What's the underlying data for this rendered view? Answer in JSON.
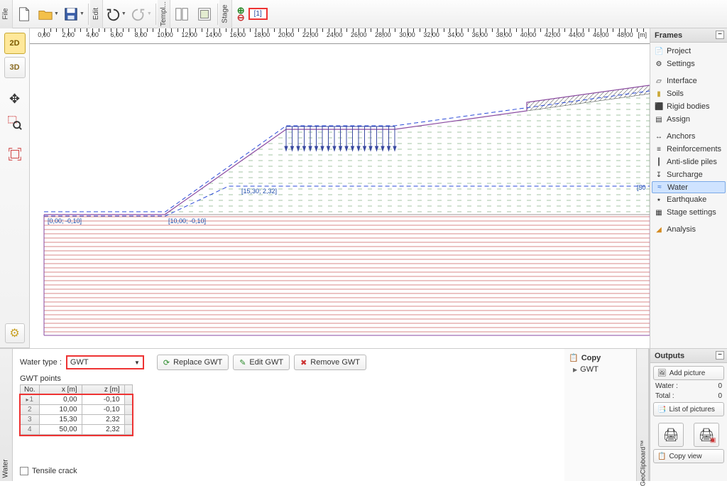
{
  "toolbar": {
    "file_tab": "File",
    "edit_tab": "Edit",
    "templ_tab": "Templ...",
    "stage_tab": "Stage",
    "stage_btn": "[1]"
  },
  "ruler": {
    "labels": [
      "0,00",
      "2,00",
      "4,00",
      "6,00",
      "8,00",
      "10,00",
      "12,00",
      "14,00",
      "16,00",
      "18,00",
      "20,00",
      "22,00",
      "24,00",
      "26,00",
      "28,00",
      "30,00",
      "32,00",
      "34,00",
      "36,00",
      "38,00",
      "40,00",
      "42,00",
      "44,00",
      "46,00",
      "48,00"
    ],
    "unit": "[m]"
  },
  "canvas": {
    "label1": "[0,00; -0,10]",
    "label2": "[10,00; -0,10]",
    "label3": "[15,30; 2,32]",
    "right_y": "[50"
  },
  "frames": {
    "title": "Frames",
    "items": [
      {
        "label": "Project",
        "icon": "📄"
      },
      {
        "label": "Settings",
        "icon": "⚙"
      },
      {
        "label": "Interface",
        "icon": "▱"
      },
      {
        "label": "Soils",
        "icon": "▮"
      },
      {
        "label": "Rigid bodies",
        "icon": "⬛"
      },
      {
        "label": "Assign",
        "icon": "▤"
      },
      {
        "label": "Anchors",
        "icon": "↔"
      },
      {
        "label": "Reinforcements",
        "icon": "≡"
      },
      {
        "label": "Anti-slide piles",
        "icon": "┃"
      },
      {
        "label": "Surcharge",
        "icon": "↧"
      },
      {
        "label": "Water",
        "icon": "≈"
      },
      {
        "label": "Earthquake",
        "icon": "⭑"
      },
      {
        "label": "Stage settings",
        "icon": "▦"
      },
      {
        "label": "Analysis",
        "icon": "◢"
      }
    ],
    "selected": 10
  },
  "water_panel": {
    "vlabel": "Water",
    "type_label": "Water type :",
    "type_value": "GWT",
    "replace_btn": "Replace GWT",
    "edit_btn": "Edit GWT",
    "remove_btn": "Remove GWT",
    "points_label": "GWT points",
    "cols": [
      "No.",
      "x [m]",
      "z [m]"
    ],
    "rows": [
      {
        "no": "1",
        "x": "0,00",
        "z": "-0,10"
      },
      {
        "no": "2",
        "x": "10,00",
        "z": "-0,10"
      },
      {
        "no": "3",
        "x": "15,30",
        "z": "2,32"
      },
      {
        "no": "4",
        "x": "50,00",
        "z": "2,32"
      }
    ],
    "tensile_label": "Tensile crack"
  },
  "copy_panel": {
    "vlabel": "GeoClipboard™",
    "title": "Copy",
    "sub": "GWT"
  },
  "outputs": {
    "title": "Outputs",
    "add_picture": "Add picture",
    "water_label": "Water :",
    "water_val": "0",
    "total_label": "Total :",
    "total_val": "0",
    "list_pictures": "List of pictures",
    "copy_view": "Copy view"
  }
}
